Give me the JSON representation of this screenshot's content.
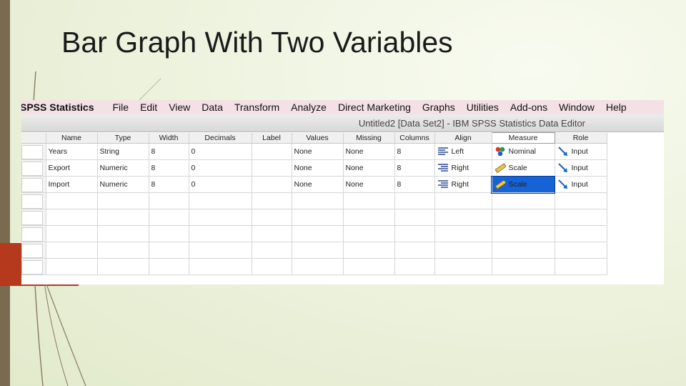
{
  "slide": {
    "title": "Bar Graph With Two Variables"
  },
  "menubar": {
    "app_name": "SPSS Statistics",
    "items": [
      "File",
      "Edit",
      "View",
      "Data",
      "Transform",
      "Analyze",
      "Direct Marketing",
      "Graphs",
      "Utilities",
      "Add-ons",
      "Window",
      "Help"
    ]
  },
  "window": {
    "title": "Untitled2 [Data Set2] - IBM SPSS Statistics Data Editor"
  },
  "grid": {
    "columns": [
      "Name",
      "Type",
      "Width",
      "Decimals",
      "Label",
      "Values",
      "Missing",
      "Columns",
      "Align",
      "Measure",
      "Role"
    ],
    "rows": [
      {
        "name": "Years",
        "type": "String",
        "width": "8",
        "decimals": "0",
        "label": "",
        "values": "None",
        "missing": "None",
        "columns": "8",
        "align": "Left",
        "measure": "Nominal",
        "role": "Input"
      },
      {
        "name": "Export",
        "type": "Numeric",
        "width": "8",
        "decimals": "0",
        "label": "",
        "values": "None",
        "missing": "None",
        "columns": "8",
        "align": "Right",
        "measure": "Scale",
        "role": "Input"
      },
      {
        "name": "Import",
        "type": "Numeric",
        "width": "8",
        "decimals": "0",
        "label": "",
        "values": "None",
        "missing": "None",
        "columns": "8",
        "align": "Right",
        "measure": "Scale",
        "role": "Input"
      }
    ],
    "empty_rows": 5,
    "selected_cell": "Import / Measure"
  },
  "icons": {
    "align": "align-lines-icon",
    "measure_nominal": "nominal-balls-icon",
    "measure_scale": "ruler-icon",
    "role_input": "input-arrow-icon"
  },
  "colors": {
    "accent_block": "#b5391c",
    "left_bar": "#7a6a4f",
    "selection": "#1663d8",
    "role_arrow": "#1a5fc8"
  }
}
